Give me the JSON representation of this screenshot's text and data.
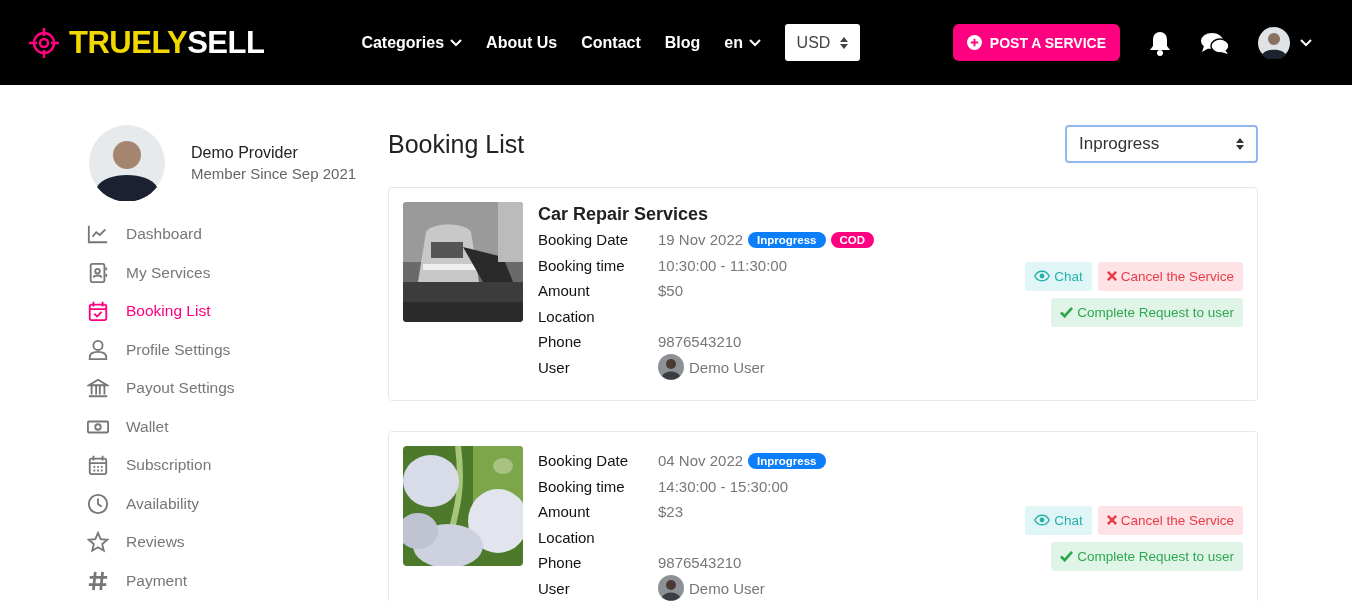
{
  "header": {
    "logo": {
      "first": "TRUELY",
      "second": "SELL"
    },
    "nav": [
      {
        "label": "Categories",
        "dropdown": true
      },
      {
        "label": "About Us",
        "dropdown": false
      },
      {
        "label": "Contact",
        "dropdown": false
      },
      {
        "label": "Blog",
        "dropdown": false
      },
      {
        "label": "en",
        "dropdown": true
      }
    ],
    "currency": "USD",
    "post_button": "POST A SERVICE"
  },
  "profile": {
    "name": "Demo Provider",
    "member_since": "Member Since Sep 2021"
  },
  "sidebar": {
    "items": [
      {
        "label": "Dashboard",
        "kind": "chart",
        "selected": false
      },
      {
        "label": "My Services",
        "kind": "contacts",
        "selected": false
      },
      {
        "label": "Booking List",
        "kind": "calendar-check",
        "selected": true
      },
      {
        "label": "Profile Settings",
        "kind": "user",
        "selected": false
      },
      {
        "label": "Payout Settings",
        "kind": "bank",
        "selected": false
      },
      {
        "label": "Wallet",
        "kind": "money",
        "selected": false
      },
      {
        "label": "Subscription",
        "kind": "calendar",
        "selected": false
      },
      {
        "label": "Availability",
        "kind": "clock",
        "selected": false
      },
      {
        "label": "Reviews",
        "kind": "star",
        "selected": false
      },
      {
        "label": "Payment",
        "kind": "hash",
        "selected": false
      }
    ]
  },
  "page_title": "Booking List",
  "status_filter": {
    "value": "Inprogress"
  },
  "bookings": [
    {
      "title": "Car Repair Services",
      "badges": [
        {
          "label": "Inprogress",
          "color": "#0d7ef9"
        },
        {
          "label": "COD",
          "color": "#ff0080"
        }
      ],
      "fields": [
        {
          "label": "Booking Date",
          "value": "19 Nov 2022",
          "kind": "date"
        },
        {
          "label": "Booking time",
          "value": "10:30:00 - 11:30:00",
          "kind": "text"
        },
        {
          "label": "Amount",
          "value": "$50",
          "kind": "text"
        },
        {
          "label": "Location",
          "kind": "text"
        },
        {
          "label": "Phone",
          "value": "9876543210",
          "kind": "text"
        },
        {
          "label": "User",
          "value": "Demo User",
          "kind": "user"
        }
      ],
      "actions": [
        {
          "label": "Chat",
          "kind": "chat"
        },
        {
          "label": "Cancel the Service",
          "kind": "cancel"
        },
        {
          "label": "Complete Request to user",
          "kind": "complete"
        }
      ]
    },
    {
      "badges": [
        {
          "label": "Inprogress",
          "color": "#0d7ef9"
        }
      ],
      "fields": [
        {
          "label": "Booking Date",
          "value": "04 Nov 2022",
          "kind": "date"
        },
        {
          "label": "Booking time",
          "value": "14:30:00 - 15:30:00",
          "kind": "text"
        },
        {
          "label": "Amount",
          "value": "$23",
          "kind": "text"
        },
        {
          "label": "Location",
          "kind": "text"
        },
        {
          "label": "Phone",
          "value": "9876543210",
          "kind": "text"
        },
        {
          "label": "User",
          "value": "Demo User",
          "kind": "user"
        }
      ],
      "actions": [
        {
          "label": "Chat",
          "kind": "chat"
        },
        {
          "label": "Cancel the Service",
          "kind": "cancel"
        },
        {
          "label": "Complete Request to user",
          "kind": "complete"
        }
      ]
    }
  ]
}
